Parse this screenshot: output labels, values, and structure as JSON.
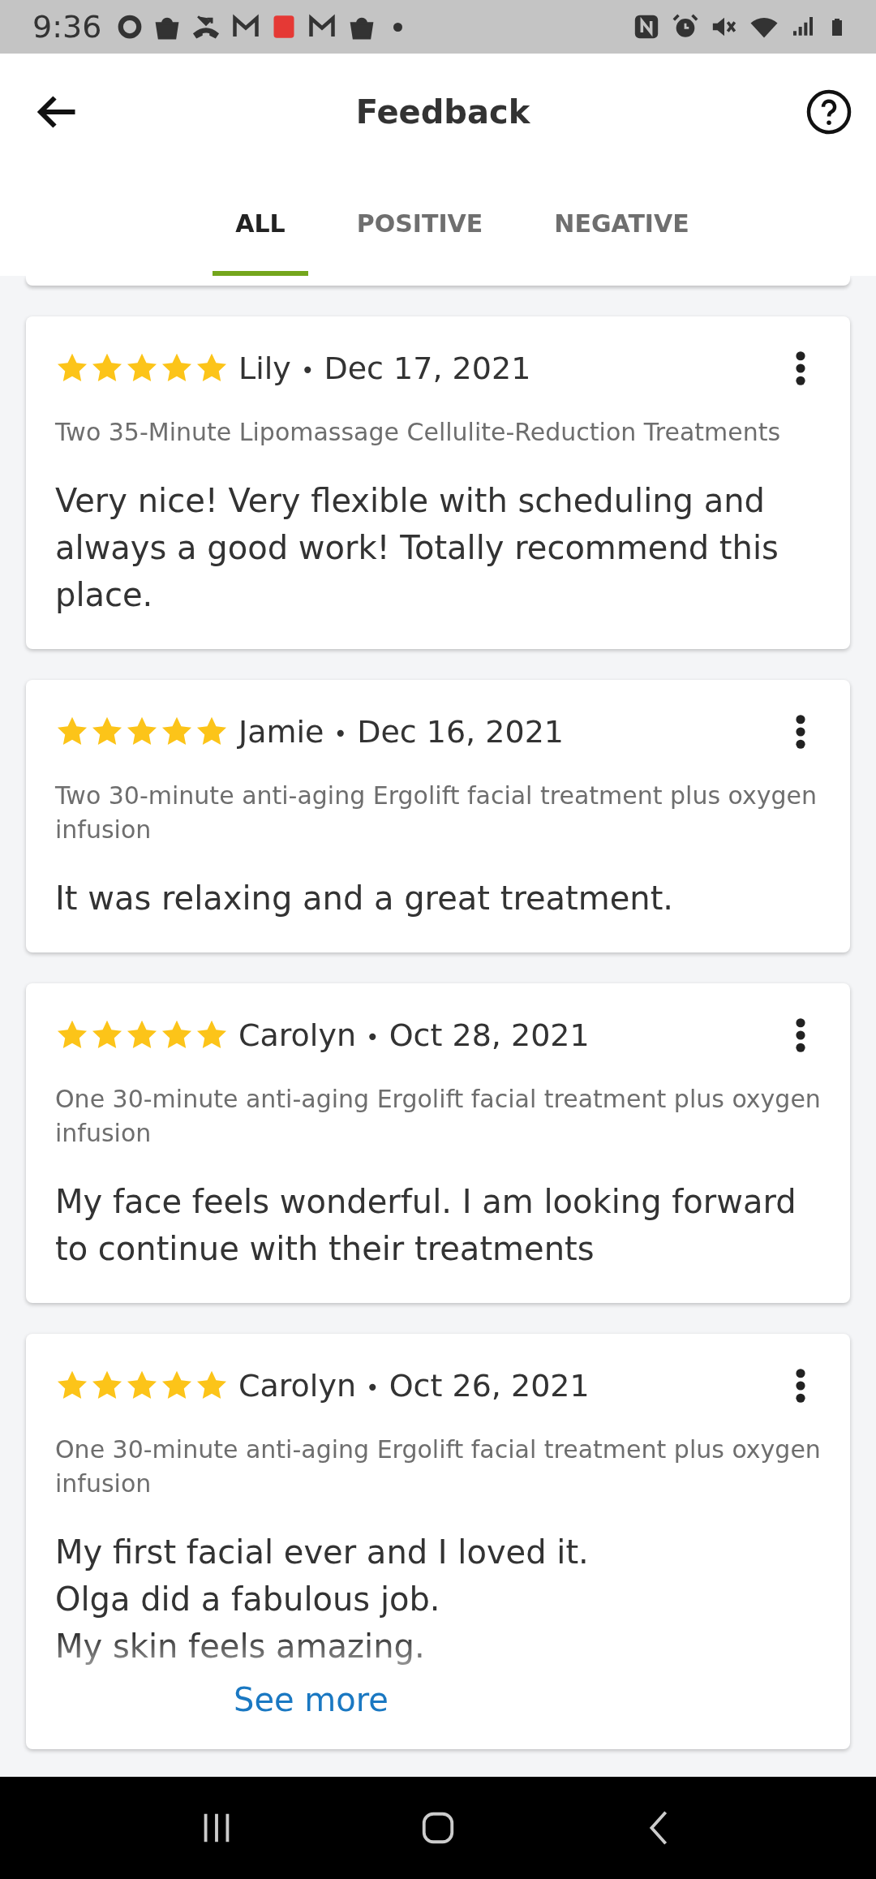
{
  "status_bar": {
    "time": "9:36"
  },
  "header": {
    "title": "Feedback"
  },
  "tabs": [
    {
      "label": "ALL",
      "selected": true
    },
    {
      "label": "POSITIVE",
      "selected": false
    },
    {
      "label": "NEGATIVE",
      "selected": false
    }
  ],
  "reviews": [
    {
      "stars": 5,
      "author": "Lily",
      "separator": "•",
      "date": "Dec 17, 2021",
      "service": "Two 35-Minute Lipomassage Cellulite-Reduction Treatments",
      "text": "Very nice! Very flexible with scheduling and always a good work! Totally recommend this place.",
      "truncated": false
    },
    {
      "stars": 5,
      "author": "Jamie",
      "separator": "•",
      "date": "Dec 16, 2021",
      "service": "Two 30-minute anti-aging Ergolift facial treatment plus oxygen infusion",
      "text": "It was relaxing and a great treatment.",
      "truncated": false
    },
    {
      "stars": 5,
      "author": "Carolyn",
      "separator": "•",
      "date": "Oct 28, 2021",
      "service": "One 30-minute anti-aging Ergolift facial treatment plus oxygen infusion",
      "text": "My face feels wonderful. I am looking forward to continue with their treatments",
      "truncated": false
    },
    {
      "stars": 5,
      "author": "Carolyn",
      "separator": "•",
      "date": "Oct 26, 2021",
      "service": "One 30-minute anti-aging Ergolift facial treatment plus oxygen infusion",
      "text": "My first facial ever and I loved it.\nOlga did a fabulous job.\nMy skin feels amazing.",
      "truncated": true,
      "more_link": "See more"
    }
  ]
}
